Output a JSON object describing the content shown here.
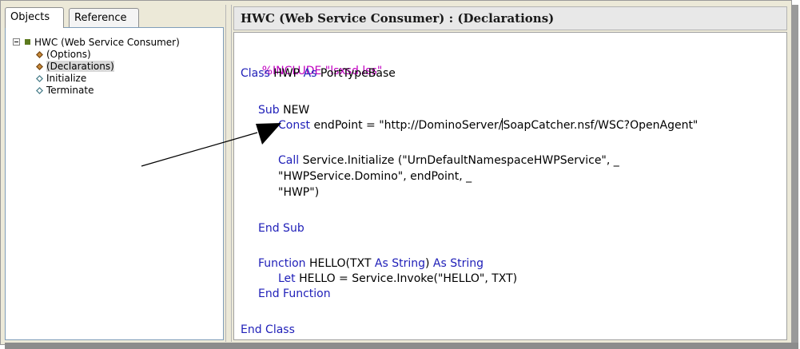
{
  "tabs": [
    {
      "label": "Objects",
      "active": true
    },
    {
      "label": "Reference",
      "active": false
    }
  ],
  "tree": {
    "root": "HWC (Web Service Consumer)",
    "children": [
      "(Options)",
      "(Declarations)",
      "Initialize",
      "Terminate"
    ],
    "selected": "(Declarations)"
  },
  "editor": {
    "title": "HWC (Web Service Consumer) : (Declarations)",
    "lines": {
      "l1": "%INCLUDE \"lsxsd.lss\"",
      "l2_kw1": "Class",
      "l2_rest1": " HWP ",
      "l2_kw2": "As",
      "l2_rest2": " PortTypeBase",
      "l3_kw": "Sub",
      "l3_rest": " NEW",
      "l4_kw": "Const",
      "l4_pre": " endPoint = \"http://DominoServer/",
      "l4_post": "SoapCatcher.nsf/WSC?OpenAgent\"",
      "l5_kw": "Call",
      "l5_rest": " Service.Initialize (\"UrnDefaultNamespaceHWPService\", _",
      "l6": "\"HWPService.Domino\", endPoint, _",
      "l7": "\"HWP\")",
      "l8": "End Sub",
      "l9_kw1": "Function",
      "l9_rest1": " HELLO(TXT ",
      "l9_kw2": "As String",
      "l9_rest2": ") ",
      "l9_kw3": "As String",
      "l10_kw": "Let",
      "l10_rest": " HELLO = Service.Invoke(\"HELLO\", TXT)",
      "l11": "End Function",
      "l12": "End Class"
    }
  },
  "colors": {
    "keyword": "#1e1eb8",
    "directive": "#c000c0",
    "tree_node": "#5c7a1e"
  },
  "icons": {
    "expander": "collapse-minus-icon",
    "root": "form-node-icon",
    "event": "lotusscript-event-icon"
  }
}
